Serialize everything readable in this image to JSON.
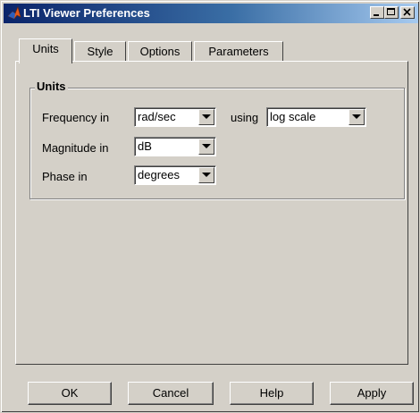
{
  "window": {
    "title": "LTI Viewer Preferences"
  },
  "tabs": [
    {
      "label": "Units",
      "active": true
    },
    {
      "label": "Style",
      "active": false
    },
    {
      "label": "Options",
      "active": false
    },
    {
      "label": "Parameters",
      "active": false
    }
  ],
  "units_group": {
    "title": "Units",
    "frequency_label": "Frequency in",
    "frequency_value": "rad/sec",
    "using_label": "using",
    "scale_value": "log scale",
    "magnitude_label": "Magnitude in",
    "magnitude_value": "dB",
    "phase_label": "Phase in",
    "phase_value": "degrees"
  },
  "buttons": {
    "ok": "OK",
    "cancel": "Cancel",
    "help": "Help",
    "apply": "Apply"
  },
  "icons": {
    "app": "matlab-icon",
    "minimize": "minimize-icon",
    "maximize": "maximize-icon",
    "close": "close-icon",
    "dropdown": "chevron-down-icon"
  },
  "colors": {
    "titlebar_start": "#0a246a",
    "titlebar_end": "#a6caf0",
    "face": "#d4d0c8"
  }
}
